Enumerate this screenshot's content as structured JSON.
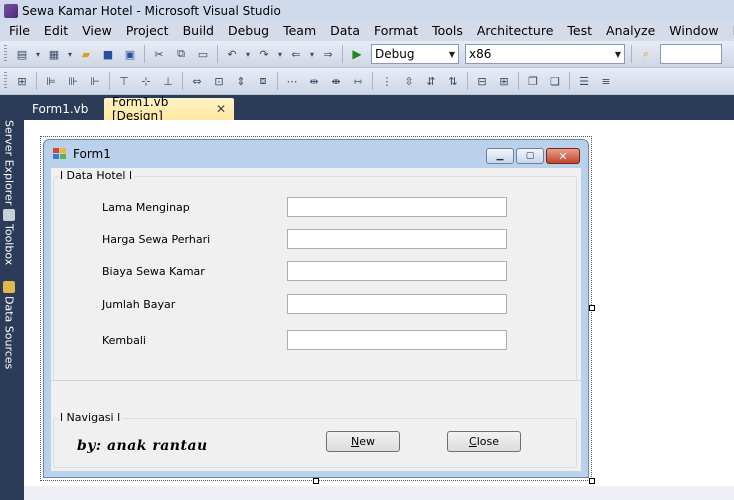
{
  "window": {
    "title": "Sewa Kamar Hotel - Microsoft Visual Studio"
  },
  "menu": [
    "File",
    "Edit",
    "View",
    "Project",
    "Build",
    "Debug",
    "Team",
    "Data",
    "Format",
    "Tools",
    "Architecture",
    "Test",
    "Analyze",
    "Window",
    "Help"
  ],
  "toolbar": {
    "config": "Debug",
    "platform": "x86"
  },
  "tabs": [
    {
      "label": "Form1.vb",
      "active": false
    },
    {
      "label": "Form1.vb [Design]",
      "active": true
    }
  ],
  "side_panels": [
    "Server Explorer",
    "Toolbox",
    "Data Sources"
  ],
  "form": {
    "title": "Form1",
    "group1_title": "l Data Hotel l",
    "fields": [
      {
        "label": "Lama Menginap",
        "value": ""
      },
      {
        "label": "Harga Sewa Perhari",
        "value": ""
      },
      {
        "label": "Biaya Sewa Kamar",
        "value": ""
      },
      {
        "label": "Jumlah Bayar",
        "value": ""
      },
      {
        "label": "Kembali",
        "value": ""
      }
    ],
    "group2_title": "l Navigasi l",
    "signature": "by: anak rantau",
    "buttons": {
      "new_mnemonic": "N",
      "new_rest": "ew",
      "close_mnemonic": "C",
      "close_rest": "lose"
    }
  },
  "colors": {
    "accent_tab": "#ffe7a2",
    "ide_dark": "#2b3c59",
    "close_button": "#c2442b"
  }
}
